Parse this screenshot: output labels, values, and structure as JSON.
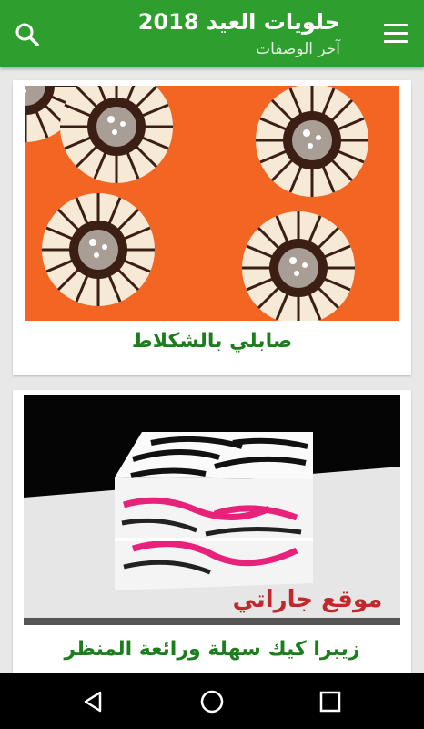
{
  "appbar": {
    "title": "حلويات العيد 2018",
    "subtitle": "آخر الوصفات",
    "search_icon": "search-icon",
    "menu_icon": "hamburger-menu-icon",
    "color": "#2e9e2e"
  },
  "recipes": [
    {
      "title": "صابلي بالشكلاط",
      "image": "chocolate-sable-cookies-photo"
    },
    {
      "title": "زيبرا كيك سهلة ورائعة المنظر",
      "image": "zebra-cake-slice-photo",
      "watermark": "موقع جاراتي"
    }
  ],
  "navbar": {
    "back_icon": "back-triangle-icon",
    "home_icon": "home-circle-icon",
    "recent_icon": "recent-apps-square-icon"
  },
  "colors": {
    "caption": "#1c7d1c",
    "background": "#e8e8e8"
  }
}
